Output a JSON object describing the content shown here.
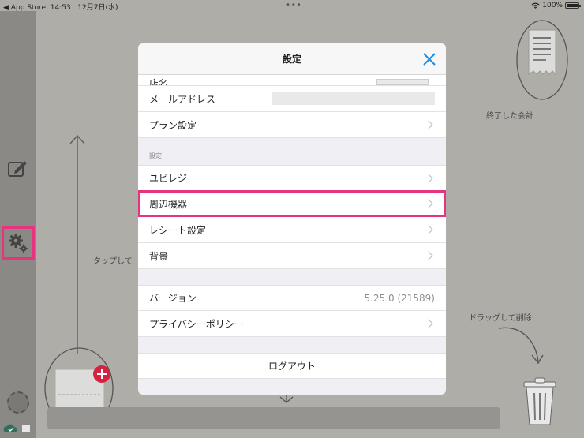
{
  "status_bar": {
    "back_app": "◀ App Store",
    "time": "14:53",
    "date": "12月7日(水)",
    "dots": "•••",
    "battery": "100%"
  },
  "background": {
    "hint_tap": "タップして",
    "hint_finished": "終了した会計",
    "hint_drag": "ドラッグして削除"
  },
  "modal": {
    "title": "設定",
    "partial_row": "店名",
    "account_rows": [
      {
        "label": "メールアドレス"
      },
      {
        "label": "プラン設定"
      }
    ],
    "section_label": "設定",
    "settings_rows": [
      {
        "label": "ユビレジ"
      },
      {
        "label": "周辺機器"
      },
      {
        "label": "レシート設定"
      },
      {
        "label": "背景"
      }
    ],
    "version_label": "バージョン",
    "version_value": "5.25.0 (21589)",
    "privacy_label": "プライバシーポリシー",
    "logout_label": "ログアウト"
  },
  "colors": {
    "highlight": "#e8337f",
    "accent_blue": "#1a8ce6"
  }
}
